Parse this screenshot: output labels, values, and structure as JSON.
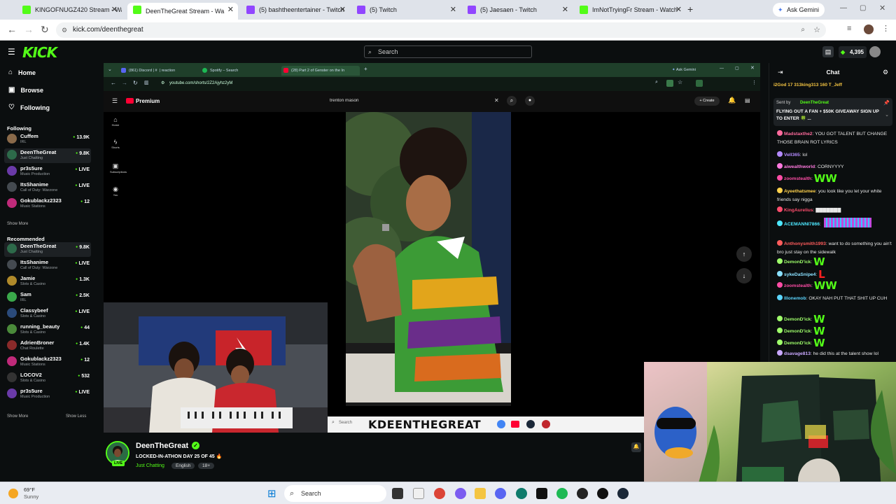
{
  "browser": {
    "tabs": [
      {
        "label": "KINGOFNUGZ420 Stream - Wa",
        "active": false
      },
      {
        "label": "DeenTheGreat Stream - Wa",
        "active": true
      },
      {
        "label": "(5) bashtheentertainer - Twitch",
        "active": false
      },
      {
        "label": "(5) Twitch",
        "active": false
      },
      {
        "label": "(5) Jaesaen - Twitch",
        "active": false
      },
      {
        "label": "ImNotTryingFr Stream - Watch",
        "active": false
      }
    ],
    "ask_gemini": "Ask Gemini",
    "url": "kick.com/deenthegreat",
    "add_tab": "+"
  },
  "kick": {
    "logo": "KICK",
    "search_placeholder": "Search",
    "kicks_count": "4,395"
  },
  "sidebar": {
    "nav": [
      {
        "label": "Home"
      },
      {
        "label": "Browse"
      },
      {
        "label": "Following"
      }
    ],
    "following_title": "Following",
    "following": [
      {
        "name": "Cuffem",
        "category": "IRL",
        "viewers": "13.9K",
        "color": "#8a6a4a"
      },
      {
        "name": "DeenTheGreat",
        "category": "Just Chatting",
        "viewers": "9.8K",
        "color": "#2d6a4a"
      },
      {
        "name": "pr3s5ure",
        "category": "Music Production",
        "viewers": "LIVE",
        "color": "#6a3aa8"
      },
      {
        "name": "ItsShanime",
        "category": "Call of Duty: Warzone",
        "viewers": "LIVE",
        "color": "#444a50"
      },
      {
        "name": "Gokublackz2323",
        "category": "Music Stations",
        "viewers": "12",
        "color": "#c02a7a"
      }
    ],
    "show_more_1": "Show More",
    "recommended_title": "Recommended",
    "recommended": [
      {
        "name": "DeenTheGreat",
        "category": "Just Chatting",
        "viewers": "9.8K",
        "color": "#2d6a4a"
      },
      {
        "name": "ItsShanime",
        "category": "Call of Duty: Warzone",
        "viewers": "LIVE",
        "color": "#444a50"
      },
      {
        "name": "Jamie",
        "category": "Slots & Casino",
        "viewers": "1.3K",
        "color": "#b08a2a"
      },
      {
        "name": "Sam",
        "category": "IRL",
        "viewers": "2.5K",
        "color": "#3aa84a"
      },
      {
        "name": "Classybeef",
        "category": "Slots & Casino",
        "viewers": "LIVE",
        "color": "#2a4a7a"
      },
      {
        "name": "running_beauty",
        "category": "Slots & Casino",
        "viewers": "44",
        "color": "#4a8a3a"
      },
      {
        "name": "AdrienBroner",
        "category": "Chat Roulette",
        "viewers": "1.4K",
        "color": "#8a2a2a"
      },
      {
        "name": "Gokublackz2323",
        "category": "Music Stations",
        "viewers": "12",
        "color": "#c02a7a"
      },
      {
        "name": "LOCOV2",
        "category": "Slots & Casino",
        "viewers": "532",
        "color": "#333"
      },
      {
        "name": "pr3s5ure",
        "category": "Music Production",
        "viewers": "LIVE",
        "color": "#6a3aa8"
      }
    ],
    "show_more_2": "Show More",
    "show_less": "Show Less"
  },
  "player": {
    "inner_tabs": [
      {
        "label": "(861) Discord | #  | reaction",
        "color": "#5865f2"
      },
      {
        "label": "Spotify – Search",
        "color": "#1db954"
      },
      {
        "label": "(28) Part 2 of Genster on the In",
        "color": "#ff0033"
      }
    ],
    "inner_ask_gemini": "Ask Gemini",
    "inner_url": "youtube.com/shorts/2Z2Ajyhz2yM",
    "yt_logo": "Premium",
    "yt_search": "trenton mason",
    "yt_create": "Create",
    "yt_side": [
      {
        "label": "Home",
        "glyph": "⌂"
      },
      {
        "label": "Shorts",
        "glyph": "ϟ"
      },
      {
        "label": "Subscriptions",
        "glyph": "▣"
      },
      {
        "label": "You",
        "glyph": "◉"
      }
    ],
    "overlay_search": "Search",
    "overlay_name": "KDEENTHEGREAT"
  },
  "stream": {
    "name": "DeenTheGreat",
    "title": "LOCKED-IN-ATHON DAY 25 OF 45 🔥",
    "category": "Just Chatting",
    "tags": [
      "English",
      "18+"
    ],
    "live": "LIVE"
  },
  "chat": {
    "title": "Chat",
    "top_line": "i2God 17    313king313 160    T_Jeff",
    "pinned_sender_prefix": "Sent by",
    "pinned_sender": "DeenTheGreat",
    "pinned_text": "FLYING OUT A FAN + $50K GIVEAWAY SIGN UP TO ENTER 🍀 ...",
    "messages": [
      {
        "user": "Madstaxthe2",
        "text": "YOU GOT TALENT BUT CHANGE THOSE BRAIN ROT LYRICS",
        "color": "#ff6b9d"
      },
      {
        "user": "Vell365",
        "text": "lol",
        "color": "#b48aff"
      },
      {
        "user": "aiwealthworld",
        "text": "CORNYYYY",
        "color": "#ff7adf"
      },
      {
        "user": "zoomstealth",
        "text": "WW",
        "color": "#ff4da6"
      },
      {
        "user": "Ayeethatsmee",
        "text": "you look like you let your white friends say nigga",
        "color": "#ffd24d"
      },
      {
        "user": "KingAurelius",
        "text": "▇▇▇▇▇▇▇",
        "color": "#ff4d6d"
      },
      {
        "user": "ACEMANNI7866",
        "text": "",
        "color": "#4de8ff"
      },
      {
        "user": "Anthonysmith1993",
        "text": "want to do something you ain't bro just stay on the sidewalk",
        "color": "#ff5c5c"
      },
      {
        "user": "DemonD'ick",
        "text": "W",
        "color": "#9fff6b"
      },
      {
        "user": "sykeDaSnipe4",
        "text": "L",
        "color": "#8ae0ff"
      },
      {
        "user": "zoomstealth",
        "text": "WW",
        "color": "#ff4da6"
      },
      {
        "user": "lllonemob",
        "text": "OKAY NAH PUT THAT SHIT UP CUH",
        "color": "#5cd6ff"
      },
      {
        "user": "DemonD'ick",
        "text": "W",
        "color": "#9fff6b"
      },
      {
        "user": "DemonD'ick",
        "text": "W",
        "color": "#9fff6b"
      },
      {
        "user": "DemonD'ick",
        "text": "W",
        "color": "#9fff6b"
      },
      {
        "user": "dsavage813",
        "text": "he did this at the talent show lol",
        "color": "#c9a8ff"
      }
    ]
  },
  "taskbar": {
    "weather_temp": "69°F",
    "weather_desc": "Sunny",
    "search": "Search"
  },
  "colors": {
    "kick_green": "#53fc18",
    "background": "#0b0e0f"
  }
}
